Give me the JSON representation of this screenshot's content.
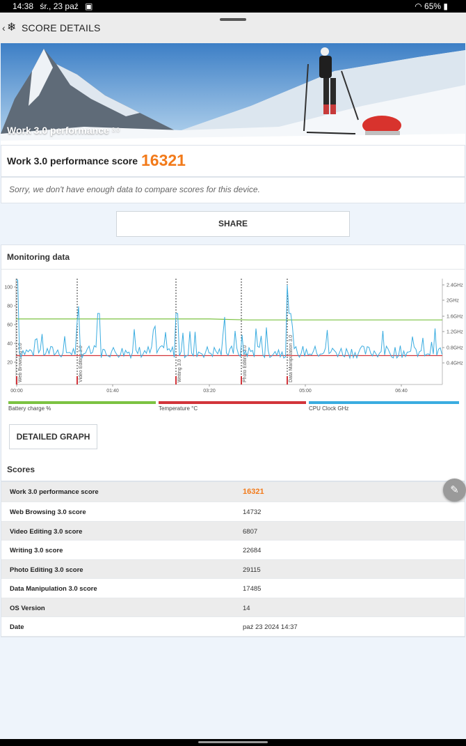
{
  "status_bar": {
    "time": "14:38",
    "date": "śr., 23 paź",
    "battery": "65%"
  },
  "app_bar": {
    "title": "SCORE DETAILS"
  },
  "hero": {
    "title": "Work 3.0 performance",
    "version": "3.0"
  },
  "score": {
    "label": "Work 3.0 performance score",
    "value": "16321"
  },
  "compare_message": "Sorry, we don't have enough data to compare scores for this device.",
  "share_label": "SHARE",
  "monitoring": {
    "heading": "Monitoring data",
    "detailed_graph_label": "DETAILED GRAPH"
  },
  "chart_data": {
    "type": "line",
    "y_left_ticks": [
      "100",
      "80",
      "60",
      "40",
      "20"
    ],
    "y_right_ticks": [
      "2.4GHz",
      "2GHz",
      "1.6GHz",
      "1.2GHz",
      "0.8GHz",
      "0.4GHz"
    ],
    "x_ticks": [
      "00:00",
      "01:40",
      "03:20",
      "05:00",
      "06:40"
    ],
    "phases": [
      "Web Browsing 3.0",
      "Video Editing 3.0",
      "Writing 3.0",
      "Photo Editing 3.0",
      "Data Manipulation 3.0"
    ],
    "legend": [
      {
        "name": "Battery charge %",
        "color": "#7cc242"
      },
      {
        "name": "Temperature °C",
        "color": "#d2343a"
      },
      {
        "name": "CPU Clock GHz",
        "color": "#3aace0"
      }
    ],
    "series": [
      {
        "name": "Battery charge %",
        "values": [
          66,
          66,
          66,
          66,
          66,
          66,
          65,
          65,
          65,
          65,
          65,
          65
        ]
      },
      {
        "name": "Temperature °C",
        "values": [
          27,
          27,
          27,
          27,
          27,
          27,
          27,
          27,
          27,
          27,
          27,
          27
        ]
      },
      {
        "name": "CPU Clock GHz",
        "values": [
          0.6,
          0.7,
          0.6,
          0.8,
          0.6,
          0.7,
          0.6,
          0.7,
          0.6,
          0.8,
          0.6,
          0.7
        ]
      }
    ]
  },
  "scores": {
    "heading": "Scores",
    "rows": [
      {
        "label": "Work 3.0 performance score",
        "value": "16321"
      },
      {
        "label": "Web Browsing 3.0 score",
        "value": "14732"
      },
      {
        "label": "Video Editing 3.0 score",
        "value": "6807"
      },
      {
        "label": "Writing 3.0 score",
        "value": "22684"
      },
      {
        "label": "Photo Editing 3.0 score",
        "value": "29115"
      },
      {
        "label": "Data Manipulation 3.0 score",
        "value": "17485"
      },
      {
        "label": "OS Version",
        "value": "14"
      },
      {
        "label": "Date",
        "value": "paź 23 2024 14:37"
      }
    ]
  },
  "colors": {
    "accent": "#f27a1a",
    "battery": "#7cc242",
    "temperature": "#d2343a",
    "cpu": "#3aace0"
  },
  "icons": [
    "back-icon",
    "snowflake-icon",
    "image-icon",
    "wifi-icon",
    "battery-icon",
    "edit-pencil-icon"
  ]
}
